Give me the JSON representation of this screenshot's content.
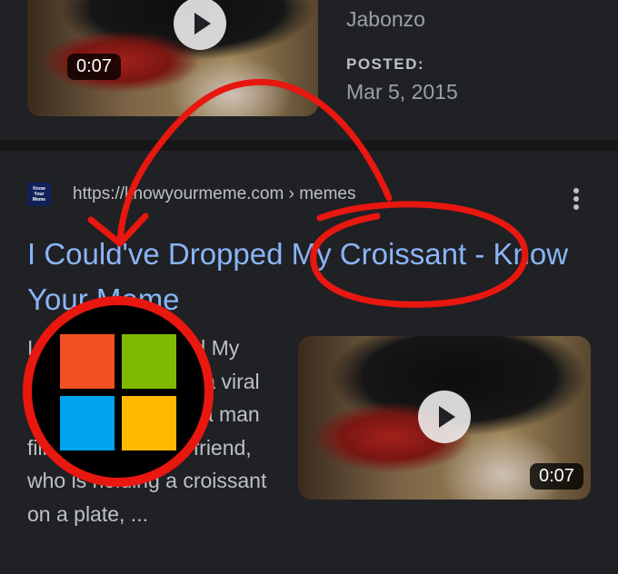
{
  "top_result": {
    "duration": "0:07",
    "author": "Jabonzo",
    "posted_label": "POSTED:",
    "posted_date": "Mar 5, 2015"
  },
  "result": {
    "favicon_lines": [
      "Know",
      "Your",
      "Meme"
    ],
    "url": "https://knowyourmeme.com › memes",
    "title": "I Could've Dropped My Croissant - Know Your Meme",
    "snippet": "I Could've Dropped My Croissant refers to a viral video clip in which a man filming scares his friend, who is holding a croissant on a plate, ...",
    "duration": "0:07"
  },
  "annotation": {
    "marker_color": "#e8170f",
    "logo_colors": [
      "#f25022",
      "#7fba00",
      "#00a4ef",
      "#ffb900"
    ],
    "logo_icon": "microsoft-logo-icon"
  }
}
